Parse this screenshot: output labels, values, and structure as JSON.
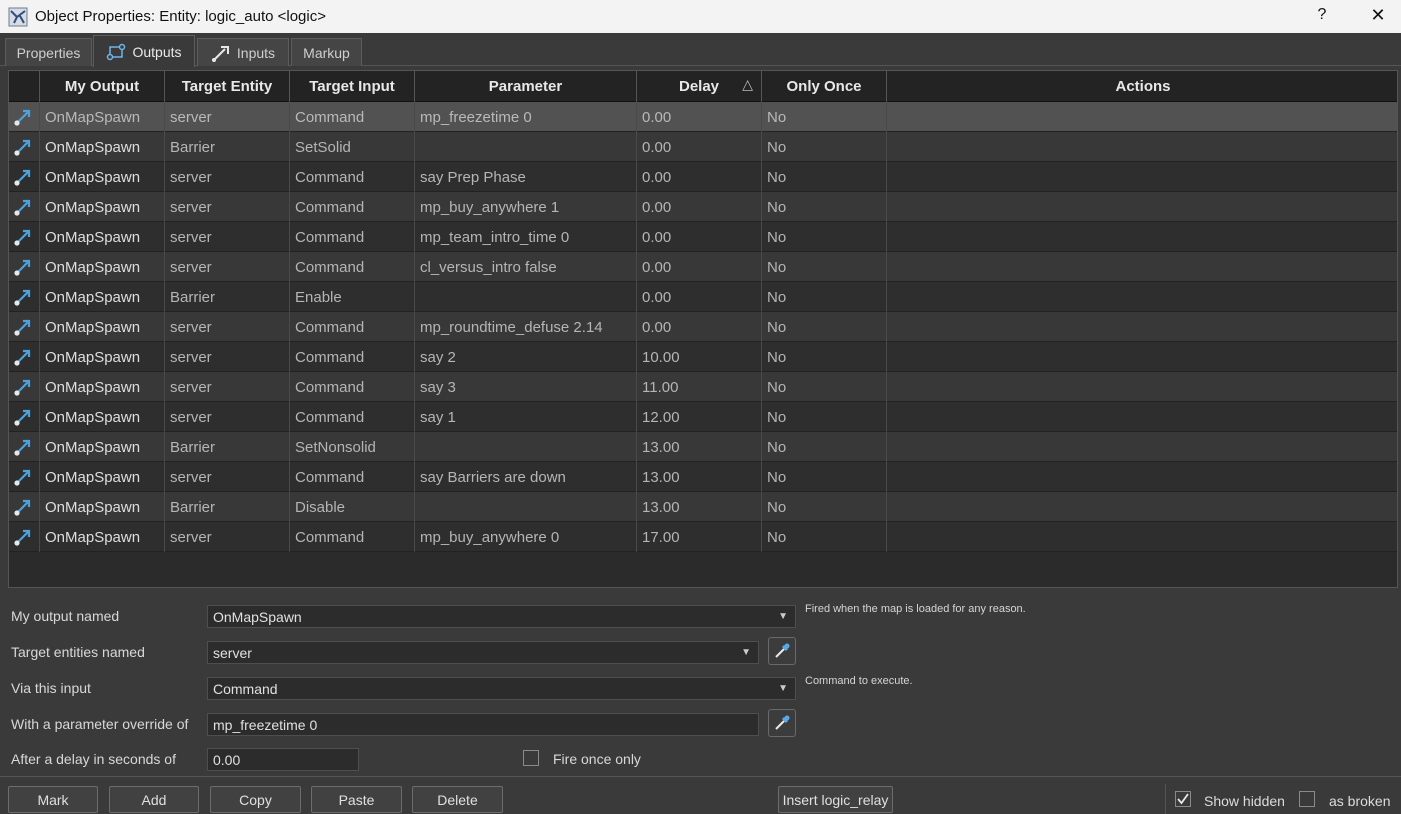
{
  "window": {
    "title": "Object Properties: Entity: logic_auto <logic>",
    "help_label": "?",
    "close_label": "✕"
  },
  "tabs": [
    {
      "label": "Properties",
      "active": false
    },
    {
      "label": "Outputs",
      "active": true
    },
    {
      "label": "Inputs",
      "active": false
    },
    {
      "label": "Markup",
      "active": false
    }
  ],
  "grid": {
    "columns": [
      "My Output",
      "Target Entity",
      "Target Input",
      "Parameter",
      "Delay",
      "Only Once",
      "Actions"
    ],
    "sort_indicator": "△",
    "rows": [
      {
        "output": "OnMapSpawn",
        "target": "server",
        "input": "Command",
        "param": "mp_freezetime 0",
        "delay": "0.00",
        "once": "No",
        "actions": ""
      },
      {
        "output": "OnMapSpawn",
        "target": "Barrier",
        "input": "SetSolid",
        "param": "",
        "delay": "0.00",
        "once": "No",
        "actions": ""
      },
      {
        "output": "OnMapSpawn",
        "target": "server",
        "input": "Command",
        "param": "say Prep Phase",
        "delay": "0.00",
        "once": "No",
        "actions": ""
      },
      {
        "output": "OnMapSpawn",
        "target": "server",
        "input": "Command",
        "param": "mp_buy_anywhere 1",
        "delay": "0.00",
        "once": "No",
        "actions": ""
      },
      {
        "output": "OnMapSpawn",
        "target": "server",
        "input": "Command",
        "param": "mp_team_intro_time 0",
        "delay": "0.00",
        "once": "No",
        "actions": ""
      },
      {
        "output": "OnMapSpawn",
        "target": "server",
        "input": "Command",
        "param": "cl_versus_intro false",
        "delay": "0.00",
        "once": "No",
        "actions": ""
      },
      {
        "output": "OnMapSpawn",
        "target": "Barrier",
        "input": "Enable",
        "param": "",
        "delay": "0.00",
        "once": "No",
        "actions": ""
      },
      {
        "output": "OnMapSpawn",
        "target": "server",
        "input": "Command",
        "param": "mp_roundtime_defuse 2.14",
        "delay": "0.00",
        "once": "No",
        "actions": ""
      },
      {
        "output": "OnMapSpawn",
        "target": "server",
        "input": "Command",
        "param": "say 2",
        "delay": "10.00",
        "once": "No",
        "actions": ""
      },
      {
        "output": "OnMapSpawn",
        "target": "server",
        "input": "Command",
        "param": "say 3",
        "delay": "11.00",
        "once": "No",
        "actions": ""
      },
      {
        "output": "OnMapSpawn",
        "target": "server",
        "input": "Command",
        "param": "say 1",
        "delay": "12.00",
        "once": "No",
        "actions": ""
      },
      {
        "output": "OnMapSpawn",
        "target": "Barrier",
        "input": "SetNonsolid",
        "param": "",
        "delay": "13.00",
        "once": "No",
        "actions": ""
      },
      {
        "output": "OnMapSpawn",
        "target": "server",
        "input": "Command",
        "param": "say Barriers are down",
        "delay": "13.00",
        "once": "No",
        "actions": ""
      },
      {
        "output": "OnMapSpawn",
        "target": "Barrier",
        "input": "Disable",
        "param": "",
        "delay": "13.00",
        "once": "No",
        "actions": ""
      },
      {
        "output": "OnMapSpawn",
        "target": "server",
        "input": "Command",
        "param": "mp_buy_anywhere 0",
        "delay": "17.00",
        "once": "No",
        "actions": ""
      }
    ]
  },
  "editor": {
    "output_label": "My output named",
    "output_value": "OnMapSpawn",
    "output_hint": "Fired when the map is loaded for any reason.",
    "target_label": "Target entities named",
    "target_value": "server",
    "input_label": "Via this input",
    "input_value": "Command",
    "input_hint": "Command to execute.",
    "param_label": "With a parameter override of",
    "param_value": "mp_freezetime 0",
    "delay_label": "After a delay in seconds of",
    "delay_value": "0.00",
    "fire_once_label": "Fire once only",
    "fire_once_checked": false
  },
  "buttons": {
    "mark": "Mark",
    "add": "Add",
    "copy": "Copy",
    "paste": "Paste",
    "delete": "Delete",
    "insert_relay": "Insert logic_relay"
  },
  "options": {
    "show_hidden_label": "Show hidden",
    "show_hidden_checked": true,
    "as_broken_label": "as broken",
    "as_broken_checked": false
  },
  "colors": {
    "accent_icon": "#4aa3df",
    "background": "#3a3a3a",
    "grid_bg": "#2b2b2b",
    "selected_row": "#525252"
  },
  "icons": {
    "app": "hammer-editor-icon",
    "row": "output-connection-icon",
    "picker": "eyedropper-icon"
  }
}
